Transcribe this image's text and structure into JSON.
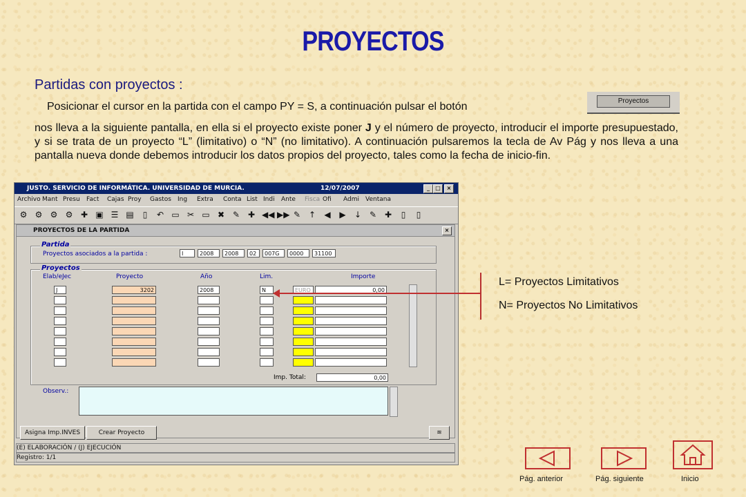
{
  "slide": {
    "title": "PROYECTOS",
    "subtitle": "Partidas con proyectos :",
    "intro": "Posicionar el cursor en la partida con el campo PY = S, a continuación pulsar el botón",
    "button_image_label": "Proyectos",
    "para1": "nos lleva a la siguiente pantalla, en ella si el proyecto existe poner ",
    "para_bold": "J",
    "para2": " y el número de proyecto, introducir el importe presupuestado, y si se trata de un proyecto “L” (limitativo) o  “N” (no limitativo). A continuación pulsaremos la tecla de Av Pág y nos lleva a una pantalla nueva donde debemos introducir los datos propios del proyecto, tales como la fecha de inicio-fin.",
    "legend_l": "L= Proyectos Limitativos",
    "legend_n": "N= Proyectos No Limitativos"
  },
  "window": {
    "title": "JUSTO. SERVICIO DE INFORMÁTICA. UNIVERSIDAD DE MURCIA.",
    "date": "12/07/2007",
    "menu": [
      "Archivo",
      "Mant",
      "Presu",
      "Fact",
      "Cajas",
      "Proy",
      "Gastos",
      "Ing",
      "Extra",
      "Conta",
      "List",
      "Indi",
      "Ante",
      "Fisca",
      "Ofi",
      "Admi",
      "Ventana"
    ],
    "inner_title": "PROYECTOS DE LA PARTIDA",
    "group_partida": "Partida",
    "partida_label": "Proyectos asociados a la partida :",
    "partida_fields": [
      "I",
      "2008",
      "2008",
      "02",
      "007G",
      "0000",
      "31100"
    ],
    "group_proyectos": "Proyectos",
    "col_elab": "Elab/eJec",
    "col_proyecto": "Proyecto",
    "col_anio": "Año",
    "col_lim": "Lim.",
    "col_importe": "Importe",
    "row1": {
      "elab": "J",
      "proyecto": "3202",
      "anio": "2008",
      "lim": "N",
      "moneda": "EURO",
      "importe": "0,00"
    },
    "imp_total_label": "Imp. Total:",
    "imp_total": "0,00",
    "observ_label": "Observ.:",
    "btn_asigna": "Asigna Imp.INVES",
    "btn_crear": "Crear Proyecto",
    "status1": "(E) ELABORACIÓN / (J) EJECUCIÓN",
    "status2": "Registro: 1/1"
  },
  "nav": {
    "prev": "Pág. anterior",
    "next": "Pág. siguiente",
    "home": "Inicio"
  }
}
